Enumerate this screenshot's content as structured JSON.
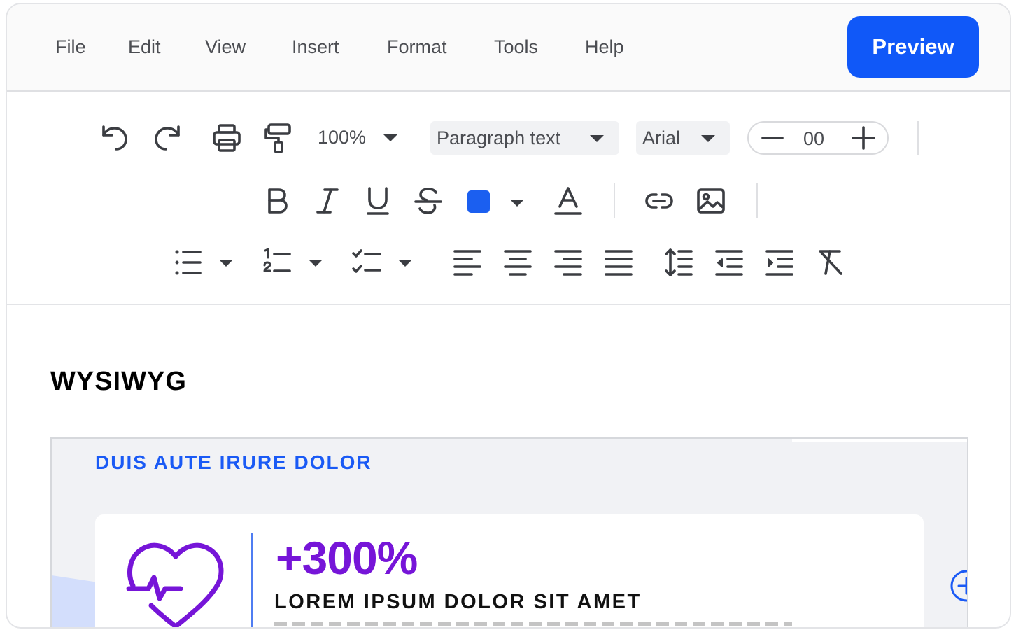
{
  "menubar": {
    "items": [
      "File",
      "Edit",
      "View",
      "Insert",
      "Format",
      "Tools",
      "Help"
    ],
    "preview_label": "Preview"
  },
  "toolbar": {
    "row1": {
      "zoom_value": "100%",
      "paragraph_style": "Paragraph text",
      "font_family": "Arial",
      "font_size": "00"
    },
    "row2": {
      "text_color": "#1b5ff0"
    },
    "icons": [
      "undo-icon",
      "redo-icon",
      "print-icon",
      "paint-format-icon",
      "bold-icon",
      "italic-icon",
      "underline-icon",
      "strikethrough-icon",
      "text-color-icon",
      "link-icon",
      "image-icon",
      "bulleted-list-icon",
      "numbered-list-icon",
      "checklist-icon",
      "align-left-icon",
      "align-center-icon",
      "align-right-icon",
      "justify-icon",
      "line-spacing-icon",
      "decrease-indent-icon",
      "increase-indent-icon",
      "clear-formatting-icon"
    ]
  },
  "document": {
    "title": "WYSIWYG",
    "embed": {
      "heading": "DUIS AUTE IRURE DOLOR",
      "stat": {
        "value": "+300%",
        "label": "LOREM IPSUM DOLOR SIT AMET"
      }
    }
  },
  "colors": {
    "accent": "#1058f8",
    "heading_blue": "#1a5af5",
    "stat_purple": "#7615d8"
  }
}
